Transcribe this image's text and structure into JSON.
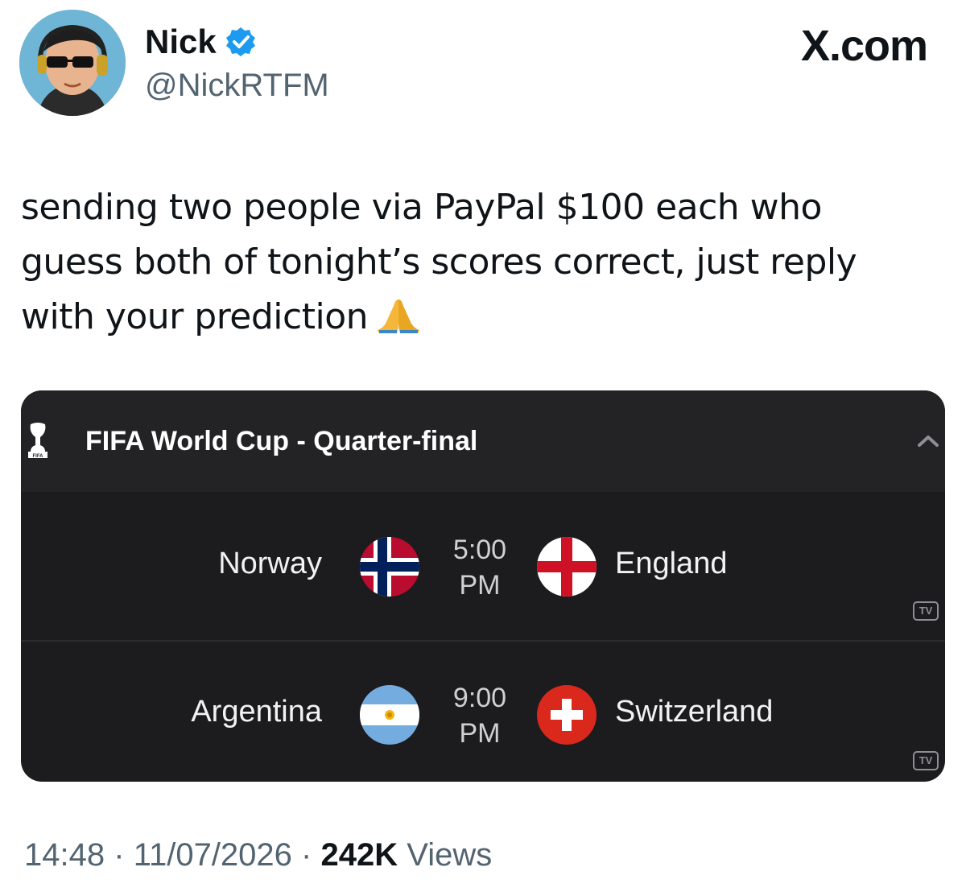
{
  "author": {
    "name": "Nick",
    "handle": "@NickRTFM",
    "verified_color": "#1d9bf0"
  },
  "brand": "X.com",
  "tweet": {
    "text": "sending two people via PayPal $100 each who guess both of tonight’s scores correct, just reply with your prediction",
    "emoji": "folded-hands"
  },
  "card": {
    "title": "FIFA World Cup - Quarter-final",
    "matches": [
      {
        "home": "Norway",
        "home_flag": "norway-flag",
        "time_line1": "5:00",
        "time_line2": "PM",
        "away": "England",
        "away_flag": "england-flag",
        "badge": "TV"
      },
      {
        "home": "Argentina",
        "home_flag": "argentina-flag",
        "time_line1": "9:00",
        "time_line2": "PM",
        "away": "Switzerland",
        "away_flag": "switzerland-flag",
        "badge": "TV"
      }
    ]
  },
  "meta": {
    "time": "14:48",
    "date": "11/07/2026",
    "separator": "·",
    "views_count": "242K",
    "views_label": "Views"
  }
}
